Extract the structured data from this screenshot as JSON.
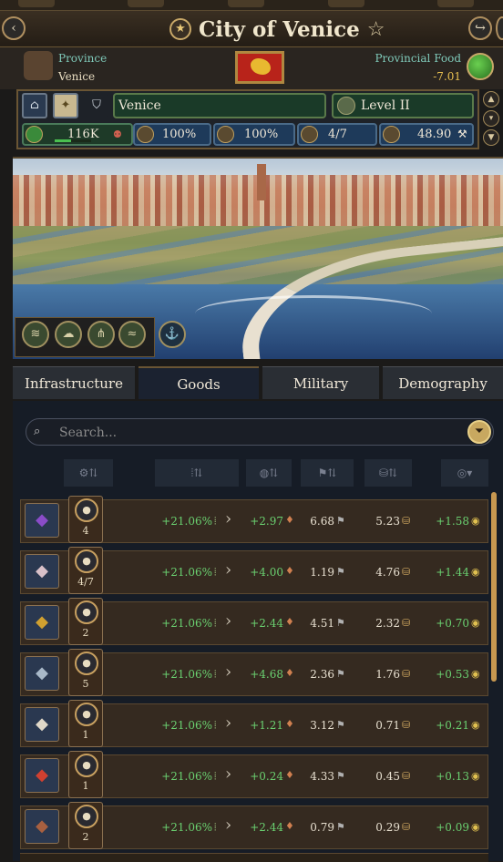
{
  "window": {
    "title": "City of Venice"
  },
  "province": {
    "label": "Province",
    "value": "Venice"
  },
  "food": {
    "label": "Provincial Food",
    "value": "-7.01"
  },
  "city": {
    "name": "Venice",
    "level": "Level II",
    "stats": {
      "population": "116K",
      "stat_2": "100%",
      "stat_3": "100%",
      "stat_4": "4/7",
      "stat_5": "48.90"
    },
    "population_bar_fraction": 0.45
  },
  "tabs": [
    {
      "label": "Infrastructure"
    },
    {
      "label": "Goods"
    },
    {
      "label": "Military"
    },
    {
      "label": "Demography"
    }
  ],
  "search": {
    "placeholder": "Search..."
  },
  "goods": [
    {
      "icon": "silk-icon",
      "producers": "4",
      "growth": "+21.06%",
      "profit": "+2.97",
      "quantity": "6.68",
      "price": "5.23",
      "income": "+1.58",
      "icon_color": "#8a4cc8"
    },
    {
      "icon": "feather-icon",
      "producers": "4/7",
      "growth": "+21.06%",
      "profit": "+4.00",
      "quantity": "1.19",
      "price": "4.76",
      "income": "+1.44",
      "icon_color": "#d8c0c8"
    },
    {
      "icon": "jewelry-icon",
      "producers": "2",
      "growth": "+21.06%",
      "profit": "+2.44",
      "quantity": "4.51",
      "price": "2.32",
      "income": "+0.70",
      "icon_color": "#d0a030"
    },
    {
      "icon": "glass-icon",
      "producers": "5",
      "growth": "+21.06%",
      "profit": "+4.68",
      "quantity": "2.36",
      "price": "1.76",
      "income": "+0.53",
      "icon_color": "#a8b8c8"
    },
    {
      "icon": "cloth-icon",
      "producers": "1",
      "growth": "+21.06%",
      "profit": "+1.21",
      "quantity": "3.12",
      "price": "0.71",
      "income": "+0.21",
      "icon_color": "#e0d8c8"
    },
    {
      "icon": "dye-icon",
      "producers": "1",
      "growth": "+21.06%",
      "profit": "+0.24",
      "quantity": "4.33",
      "price": "0.45",
      "income": "+0.13",
      "icon_color": "#d04030"
    },
    {
      "icon": "pottery-icon",
      "producers": "2",
      "growth": "+21.06%",
      "profit": "+2.44",
      "quantity": "0.79",
      "price": "0.29",
      "income": "+0.09",
      "icon_color": "#a86040"
    }
  ]
}
